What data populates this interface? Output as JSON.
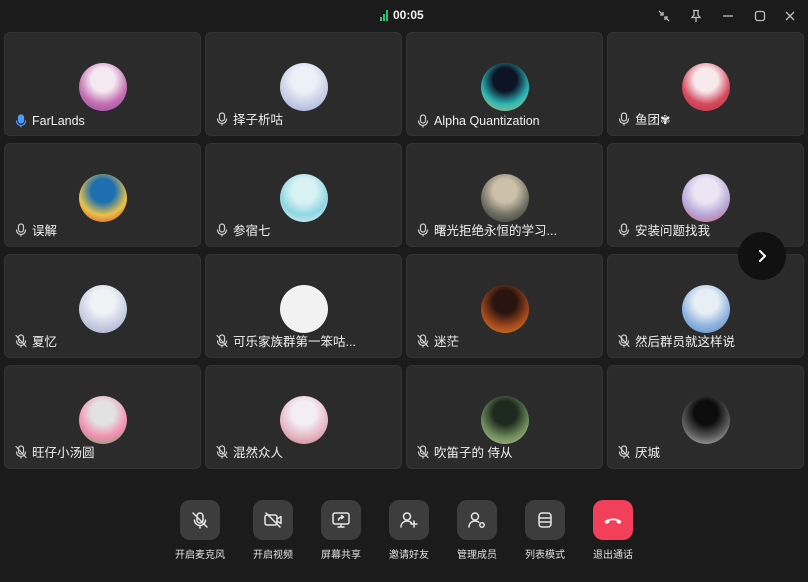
{
  "call": {
    "duration": "00:05",
    "signal_color": "#2fbf71"
  },
  "window_controls": [
    "collapse-icon",
    "pin-icon",
    "minimize-icon",
    "maximize-icon",
    "close-icon"
  ],
  "participants": [
    {
      "name": "FarLands",
      "mic": "on-active",
      "avatar_colors": [
        "#f4e9f1",
        "#c46fb0",
        "#8f4bb0"
      ]
    },
    {
      "name": "择子析咕",
      "mic": "on",
      "avatar_colors": [
        "#eef0f8",
        "#c9cfe6",
        "#9aa6d6"
      ]
    },
    {
      "name": "Alpha Quantization",
      "mic": "on",
      "avatar_colors": [
        "#0c1426",
        "#2bb5b5",
        "#e0c060"
      ]
    },
    {
      "name": "鱼团✾",
      "mic": "on",
      "avatar_colors": [
        "#f7e9ec",
        "#d44a5e",
        "#b83040"
      ]
    },
    {
      "name": "误解",
      "mic": "on",
      "avatar_colors": [
        "#1d6fb0",
        "#e8c34a",
        "#d83030"
      ]
    },
    {
      "name": "参宿七",
      "mic": "on",
      "avatar_colors": [
        "#d8f2f4",
        "#8fd6e2",
        "#f3f7fa"
      ]
    },
    {
      "name": "曙光拒绝永恒的学习...",
      "mic": "on",
      "avatar_colors": [
        "#ccc0a8",
        "#6f6f63",
        "#2e2f28"
      ]
    },
    {
      "name": "安装问题找我",
      "mic": "on",
      "avatar_colors": [
        "#ece6f4",
        "#b8a7d8",
        "#d85a6a"
      ]
    },
    {
      "name": "夏忆",
      "mic": "off",
      "avatar_colors": [
        "#f0f2f6",
        "#c8cde2",
        "#a9a3c7"
      ]
    },
    {
      "name": "可乐家族群第一笨咕...",
      "mic": "off",
      "avatar_colors": [
        "#f2f2f2",
        "#f2f2f2",
        "#f2f2f2"
      ]
    },
    {
      "name": "迷茫",
      "mic": "off",
      "avatar_colors": [
        "#2b1410",
        "#a0461c",
        "#e08a2a"
      ]
    },
    {
      "name": "然后群员就这样说",
      "mic": "off",
      "avatar_colors": [
        "#e8eef6",
        "#8fb4de",
        "#5a86c2"
      ]
    },
    {
      "name": "旺仔小汤圆",
      "mic": "off",
      "avatar_colors": [
        "#e2e2e2",
        "#f290b0",
        "#58a85a"
      ]
    },
    {
      "name": "混然众人",
      "mic": "off",
      "avatar_colors": [
        "#f3eef2",
        "#e6b8c6",
        "#c07a8a"
      ]
    },
    {
      "name": "吹笛子的 侍从",
      "mic": "off",
      "avatar_colors": [
        "#1e2a20",
        "#6c8a5a",
        "#c8c8a0"
      ]
    },
    {
      "name": "厌城",
      "mic": "off",
      "avatar_colors": [
        "#0c0c0c",
        "#5a5a5a",
        "#c8c8c8"
      ]
    }
  ],
  "next_page_icon": "chevron-right-icon",
  "toolbar": [
    {
      "label": "开启麦克风",
      "icon": "mic-off-icon",
      "style": "gray"
    },
    {
      "label": "开启视频",
      "icon": "video-off-icon",
      "style": "gray"
    },
    {
      "label": "屏幕共享",
      "icon": "screen-share-icon",
      "style": "gray"
    },
    {
      "label": "邀请好友",
      "icon": "invite-user-icon",
      "style": "gray"
    },
    {
      "label": "管理成员",
      "icon": "manage-members-icon",
      "style": "gray"
    },
    {
      "label": "列表模式",
      "icon": "list-mode-icon",
      "style": "gray"
    },
    {
      "label": "退出通话",
      "icon": "hang-up-icon",
      "style": "red",
      "color": "#f2405a"
    }
  ]
}
